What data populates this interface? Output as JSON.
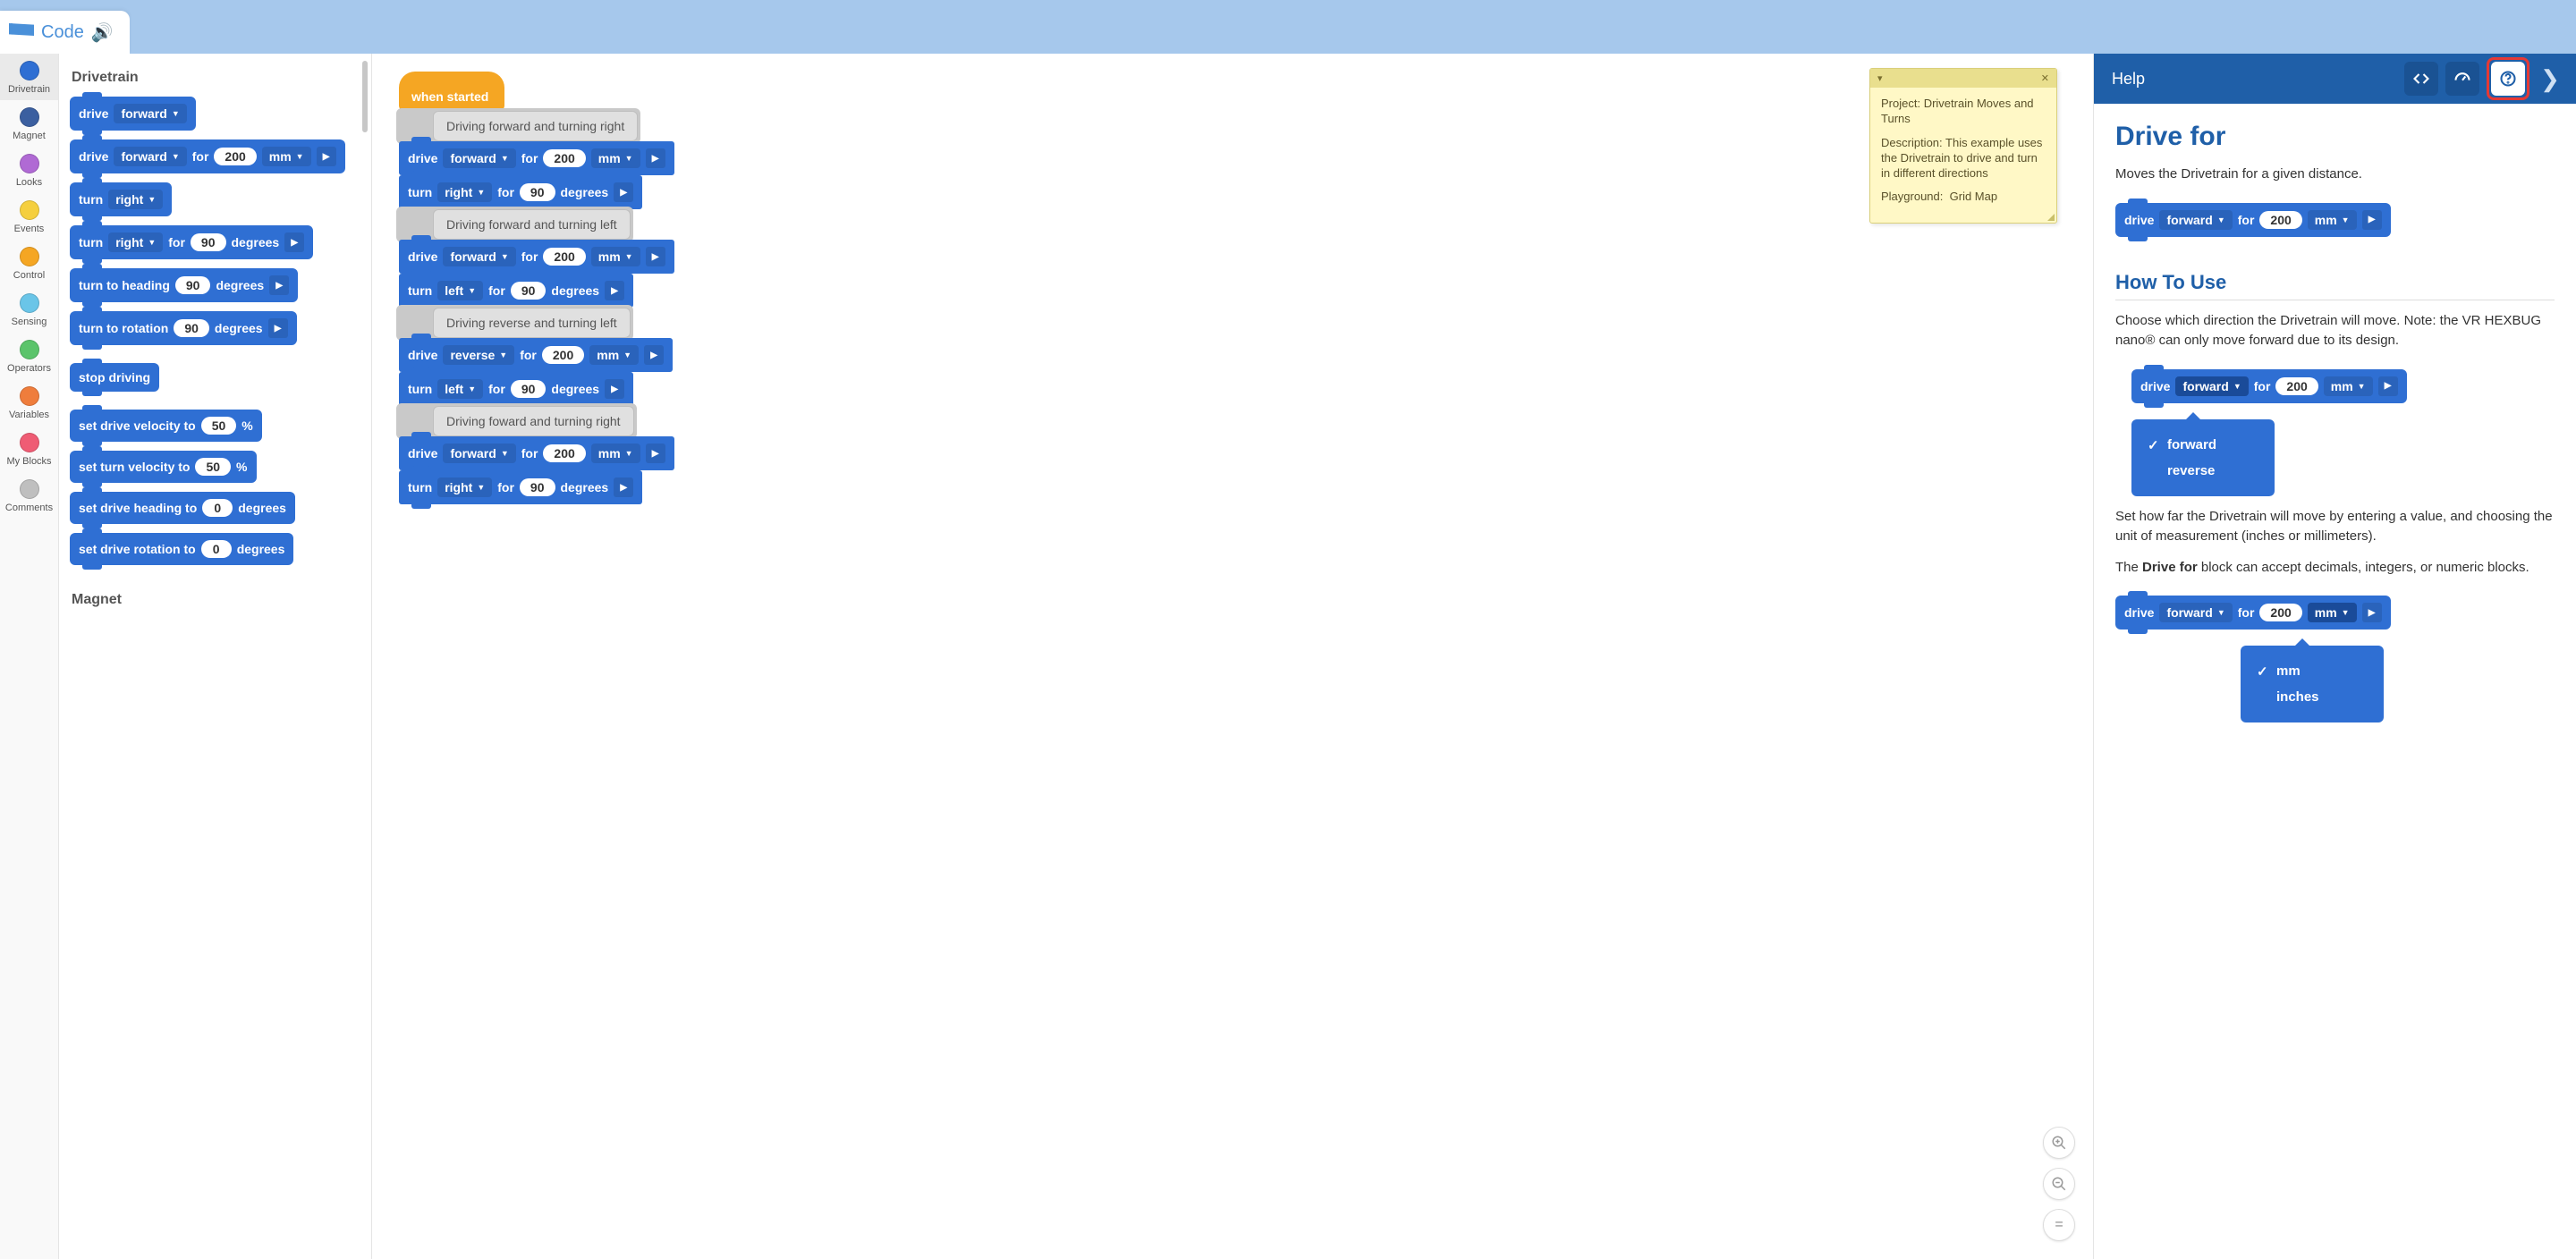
{
  "topbar": {
    "tab_label": "Code"
  },
  "categories": [
    {
      "name": "Drivetrain",
      "color": "#2f6fd3",
      "active": true
    },
    {
      "name": "Magnet",
      "color": "#3b5fa0"
    },
    {
      "name": "Looks",
      "color": "#b06ad4"
    },
    {
      "name": "Events",
      "color": "#f5cf3e"
    },
    {
      "name": "Control",
      "color": "#f5a623"
    },
    {
      "name": "Sensing",
      "color": "#6ac5e8"
    },
    {
      "name": "Operators",
      "color": "#5bc46b"
    },
    {
      "name": "Variables",
      "color": "#ef7d3c"
    },
    {
      "name": "My Blocks",
      "color": "#ef5c74"
    },
    {
      "name": "Comments",
      "color": "#bfbfbf"
    }
  ],
  "palette": {
    "title_drivetrain": "Drivetrain",
    "title_magnet": "Magnet",
    "drive": "drive",
    "forward": "forward",
    "for": "for",
    "mm": "mm",
    "turn": "turn",
    "right": "right",
    "degrees": "degrees",
    "turn_to_heading": "turn to heading",
    "turn_to_rotation": "turn to rotation",
    "stop_driving": "stop driving",
    "set_drive_velocity": "set drive velocity to",
    "percent": "%",
    "set_turn_velocity": "set turn velocity to",
    "set_drive_heading": "set drive heading to",
    "set_drive_rotation": "set drive rotation to",
    "v200": "200",
    "v90": "90",
    "v50": "50",
    "v0": "0"
  },
  "workspace": {
    "when_started": "when started",
    "comments": [
      "Driving forward and turning right",
      "Driving forward and turning left",
      "Driving reverse and turning left",
      "Driving foward and turning right"
    ],
    "drive": "drive",
    "turn": "turn",
    "for": "for",
    "forward": "forward",
    "reverse": "reverse",
    "right": "right",
    "left": "left",
    "mm": "mm",
    "degrees": "degrees",
    "v200": "200",
    "v90": "90"
  },
  "note": {
    "project_label": "Project:",
    "project": "Drivetrain Moves and Turns",
    "desc_label": "Description:",
    "desc": "This example uses the Drivetrain to drive and turn in different directions",
    "playground_label": "Playground:",
    "playground": "Grid Map"
  },
  "help": {
    "header": "Help",
    "h1": "Drive for",
    "p1": "Moves the Drivetrain for a given distance.",
    "h2": "How To Use",
    "p2": "Choose which direction the Drivetrain will move. Note: the VR HEXBUG nano® can only move forward due to its design.",
    "dd1_opts": [
      "forward",
      "reverse"
    ],
    "p3": "Set how far the Drivetrain will move by entering a value, and choosing the unit of measurement (inches or millimeters).",
    "p4_a": "The ",
    "p4_b": "Drive for",
    "p4_c": " block can accept decimals, integers, or numeric blocks.",
    "dd2_opts": [
      "mm",
      "inches"
    ],
    "drive": "drive",
    "forward": "forward",
    "for": "for",
    "mm": "mm",
    "v200": "200"
  }
}
